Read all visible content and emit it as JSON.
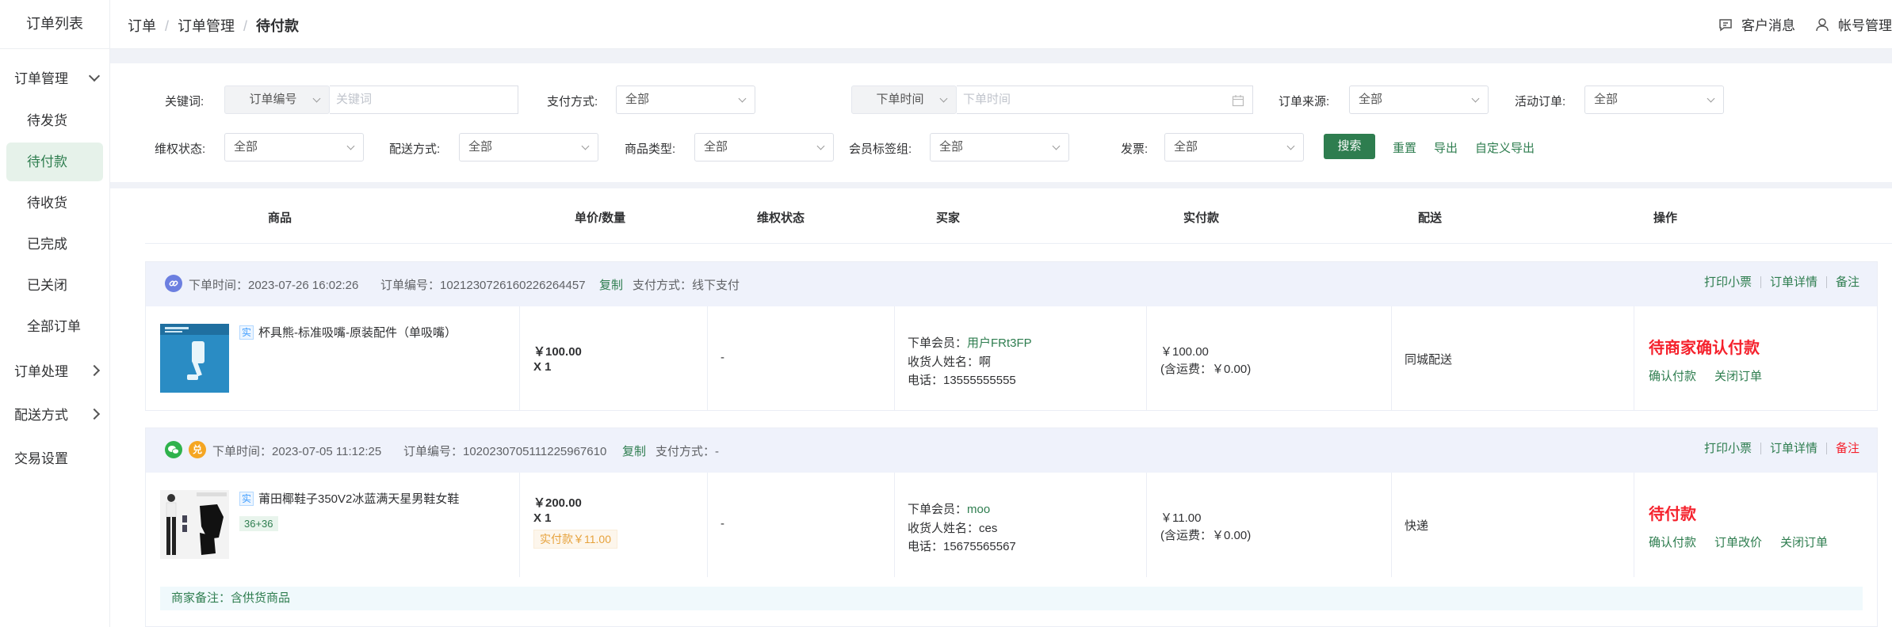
{
  "sidebar": {
    "title": "订单列表",
    "group_order_mgmt": "订单管理",
    "items": [
      "待发货",
      "待付款",
      "待收货",
      "已完成",
      "已关闭",
      "全部订单"
    ],
    "active_index": 1,
    "group_order_process": "订单处理",
    "group_delivery": "配送方式",
    "trade_settings": "交易设置"
  },
  "breadcrumb": [
    "订单",
    "订单管理",
    "待付款"
  ],
  "header": {
    "messages": "客户消息",
    "account": "帐号管理"
  },
  "filters": {
    "keyword_label": "关键词:",
    "keyword_type": "订单编号",
    "keyword_placeholder": "关键词",
    "pay_method_label": "支付方式:",
    "pay_method_value": "全部",
    "time_type": "下单时间",
    "time_placeholder": "下单时间",
    "source_label": "订单来源:",
    "source_value": "全部",
    "activity_label": "活动订单:",
    "activity_value": "全部",
    "rights_label": "维权状态:",
    "rights_value": "全部",
    "delivery_label": "配送方式:",
    "delivery_value": "全部",
    "goods_type_label": "商品类型:",
    "goods_type_value": "全部",
    "member_tag_label": "会员标签组:",
    "member_tag_value": "全部",
    "invoice_label": "发票:",
    "invoice_value": "全部",
    "search_button": "搜索",
    "reset": "重置",
    "export": "导出",
    "custom_export": "自定义导出"
  },
  "columns": [
    "商品",
    "单价/数量",
    "维权状态",
    "买家",
    "实付款",
    "配送",
    "操作"
  ],
  "orders": [
    {
      "order_time": "下单时间：2023-07-26 16:02:26",
      "order_no": "订单编号：1021230726160226264457",
      "copy": "复制",
      "pay_method": "支付方式：线下支付",
      "head_ops": [
        "打印小票",
        "订单详情",
        "备注"
      ],
      "goods_tag": "实",
      "goods_title": "杯具熊-标准吸嘴-原装配件（单吸嘴）",
      "price": "￥100.00",
      "qty": "X 1",
      "rights": "-",
      "member_label": "下单会员：",
      "member_name": "用户FRt3FP",
      "receiver": "收货人姓名：啊",
      "phone": "电话：13555555555",
      "paid": "￥100.00",
      "freight": "(含运费：￥0.00)",
      "delivery": "同城配送",
      "status": "待商家确认付款",
      "actions": [
        "确认付款",
        "关闭订单"
      ]
    },
    {
      "order_time": "下单时间：2023-07-05 11:12:25",
      "order_no": "订单编号：1020230705111225967610",
      "copy": "复制",
      "pay_method": "支付方式：-",
      "pay_badge": "兑",
      "head_ops": [
        "打印小票",
        "订单详情",
        "备注"
      ],
      "goods_tag": "实",
      "goods_title": "莆田椰鞋子350V2冰蓝满天星男鞋女鞋",
      "spec": "36+36",
      "price": "￥200.00",
      "qty": "X 1",
      "paid_badge": "实付款￥11.00",
      "rights": "-",
      "member_label": "下单会员：",
      "member_name": "moo",
      "receiver": "收货人姓名：ces",
      "phone": "电话：15675565567",
      "paid": "￥11.00",
      "freight": "(含运费：￥0.00)",
      "delivery": "快递",
      "status": "待付款",
      "actions": [
        "确认付款",
        "订单改价",
        "关闭订单"
      ],
      "remark": "商家备注：含供货商品"
    }
  ],
  "colors": {
    "primary": "#2e7d4f",
    "danger": "#f5222d",
    "link_icon": "#6c7fe0",
    "wechat": "#2fb24c",
    "badge_orange": "#f5a623"
  }
}
